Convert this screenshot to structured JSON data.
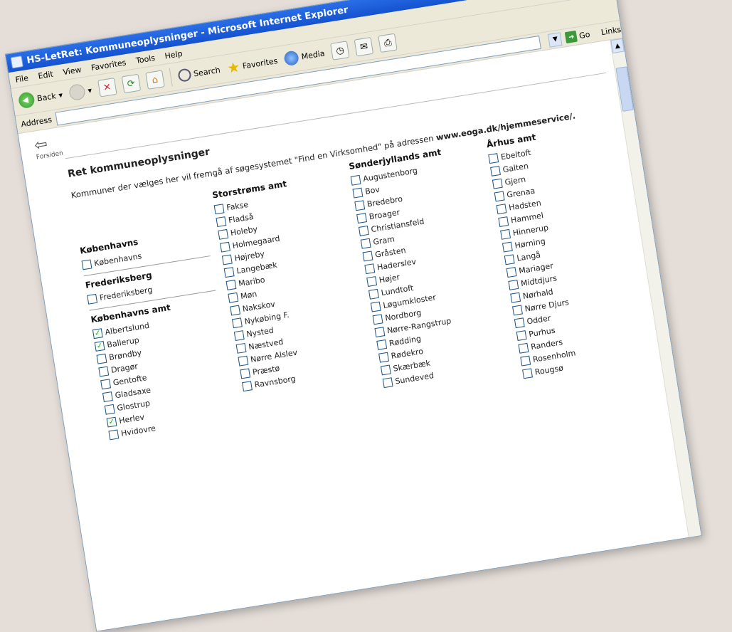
{
  "window": {
    "title": "HS-LetRet: Kommuneoplysninger - Microsoft Internet Explorer"
  },
  "menu": [
    "File",
    "Edit",
    "View",
    "Favorites",
    "Tools",
    "Help"
  ],
  "toolbar": {
    "back": "Back",
    "search": "Search",
    "favorites": "Favorites",
    "media": "Media"
  },
  "address": {
    "label": "Address",
    "value": "",
    "go": "Go",
    "links": "Links"
  },
  "nav": {
    "back_label": "Forsiden"
  },
  "page": {
    "heading": "Ret kommuneoplysninger",
    "intro_plain": "Kommuner der vælges her vil fremgå af søgesystemet \"Find en Virksomhed\" på adressen",
    "intro_bold": "www.eoga.dk/hjemmeservice/."
  },
  "columns": [
    {
      "groups": [
        {
          "title": "Københavns",
          "items": [
            {
              "label": "Københavns",
              "checked": false
            }
          ]
        },
        {
          "title": "Frederiksberg",
          "items": [
            {
              "label": "Frederiksberg",
              "checked": false
            }
          ]
        },
        {
          "title": "Københavns amt",
          "items": [
            {
              "label": "Albertslund",
              "checked": true
            },
            {
              "label": "Ballerup",
              "checked": true
            },
            {
              "label": "Brøndby",
              "checked": false
            },
            {
              "label": "Dragør",
              "checked": false
            },
            {
              "label": "Gentofte",
              "checked": false
            },
            {
              "label": "Gladsaxe",
              "checked": false
            },
            {
              "label": "Glostrup",
              "checked": false
            },
            {
              "label": "Herlev",
              "checked": true
            },
            {
              "label": "Hvidovre",
              "checked": false
            }
          ]
        }
      ]
    },
    {
      "groups": [
        {
          "title": "Storstrøms amt",
          "items": [
            {
              "label": "Fakse",
              "checked": false
            },
            {
              "label": "Fladså",
              "checked": false
            },
            {
              "label": "Holeby",
              "checked": false
            },
            {
              "label": "Holmegaard",
              "checked": false
            },
            {
              "label": "Højreby",
              "checked": false
            },
            {
              "label": "Langebæk",
              "checked": false
            },
            {
              "label": "Maribo",
              "checked": false
            },
            {
              "label": "Møn",
              "checked": false
            },
            {
              "label": "Nakskov",
              "checked": false
            },
            {
              "label": "Nykøbing F.",
              "checked": false
            },
            {
              "label": "Nysted",
              "checked": false
            },
            {
              "label": "Næstved",
              "checked": false
            },
            {
              "label": "Nørre Alslev",
              "checked": false
            },
            {
              "label": "Præstø",
              "checked": false
            },
            {
              "label": "Ravnsborg",
              "checked": false
            }
          ]
        }
      ]
    },
    {
      "groups": [
        {
          "title": "Sønderjyllands amt",
          "items": [
            {
              "label": "Augustenborg",
              "checked": false
            },
            {
              "label": "Bov",
              "checked": false
            },
            {
              "label": "Bredebro",
              "checked": false
            },
            {
              "label": "Broager",
              "checked": false
            },
            {
              "label": "Christiansfeld",
              "checked": false
            },
            {
              "label": "Gram",
              "checked": false
            },
            {
              "label": "Gråsten",
              "checked": false
            },
            {
              "label": "Haderslev",
              "checked": false
            },
            {
              "label": "Højer",
              "checked": false
            },
            {
              "label": "Lundtoft",
              "checked": false
            },
            {
              "label": "Løgumkloster",
              "checked": false
            },
            {
              "label": "Nordborg",
              "checked": false
            },
            {
              "label": "Nørre-Rangstrup",
              "checked": false
            },
            {
              "label": "Rødding",
              "checked": false
            },
            {
              "label": "Rødekro",
              "checked": false
            },
            {
              "label": "Skærbæk",
              "checked": false
            },
            {
              "label": "Sundeved",
              "checked": false
            }
          ]
        }
      ]
    },
    {
      "groups": [
        {
          "title": "Århus amt",
          "items": [
            {
              "label": "Ebeltoft",
              "checked": false
            },
            {
              "label": "Galten",
              "checked": false
            },
            {
              "label": "Gjern",
              "checked": false
            },
            {
              "label": "Grenaa",
              "checked": false
            },
            {
              "label": "Hadsten",
              "checked": false
            },
            {
              "label": "Hammel",
              "checked": false
            },
            {
              "label": "Hinnerup",
              "checked": false
            },
            {
              "label": "Hørning",
              "checked": false
            },
            {
              "label": "Langå",
              "checked": false
            },
            {
              "label": "Mariager",
              "checked": false
            },
            {
              "label": "Midtdjurs",
              "checked": false
            },
            {
              "label": "Nørhald",
              "checked": false
            },
            {
              "label": "Nørre Djurs",
              "checked": false
            },
            {
              "label": "Odder",
              "checked": false
            },
            {
              "label": "Purhus",
              "checked": false
            },
            {
              "label": "Randers",
              "checked": false
            },
            {
              "label": "Rosenholm",
              "checked": false
            },
            {
              "label": "Rougsø",
              "checked": false
            }
          ]
        }
      ]
    }
  ]
}
